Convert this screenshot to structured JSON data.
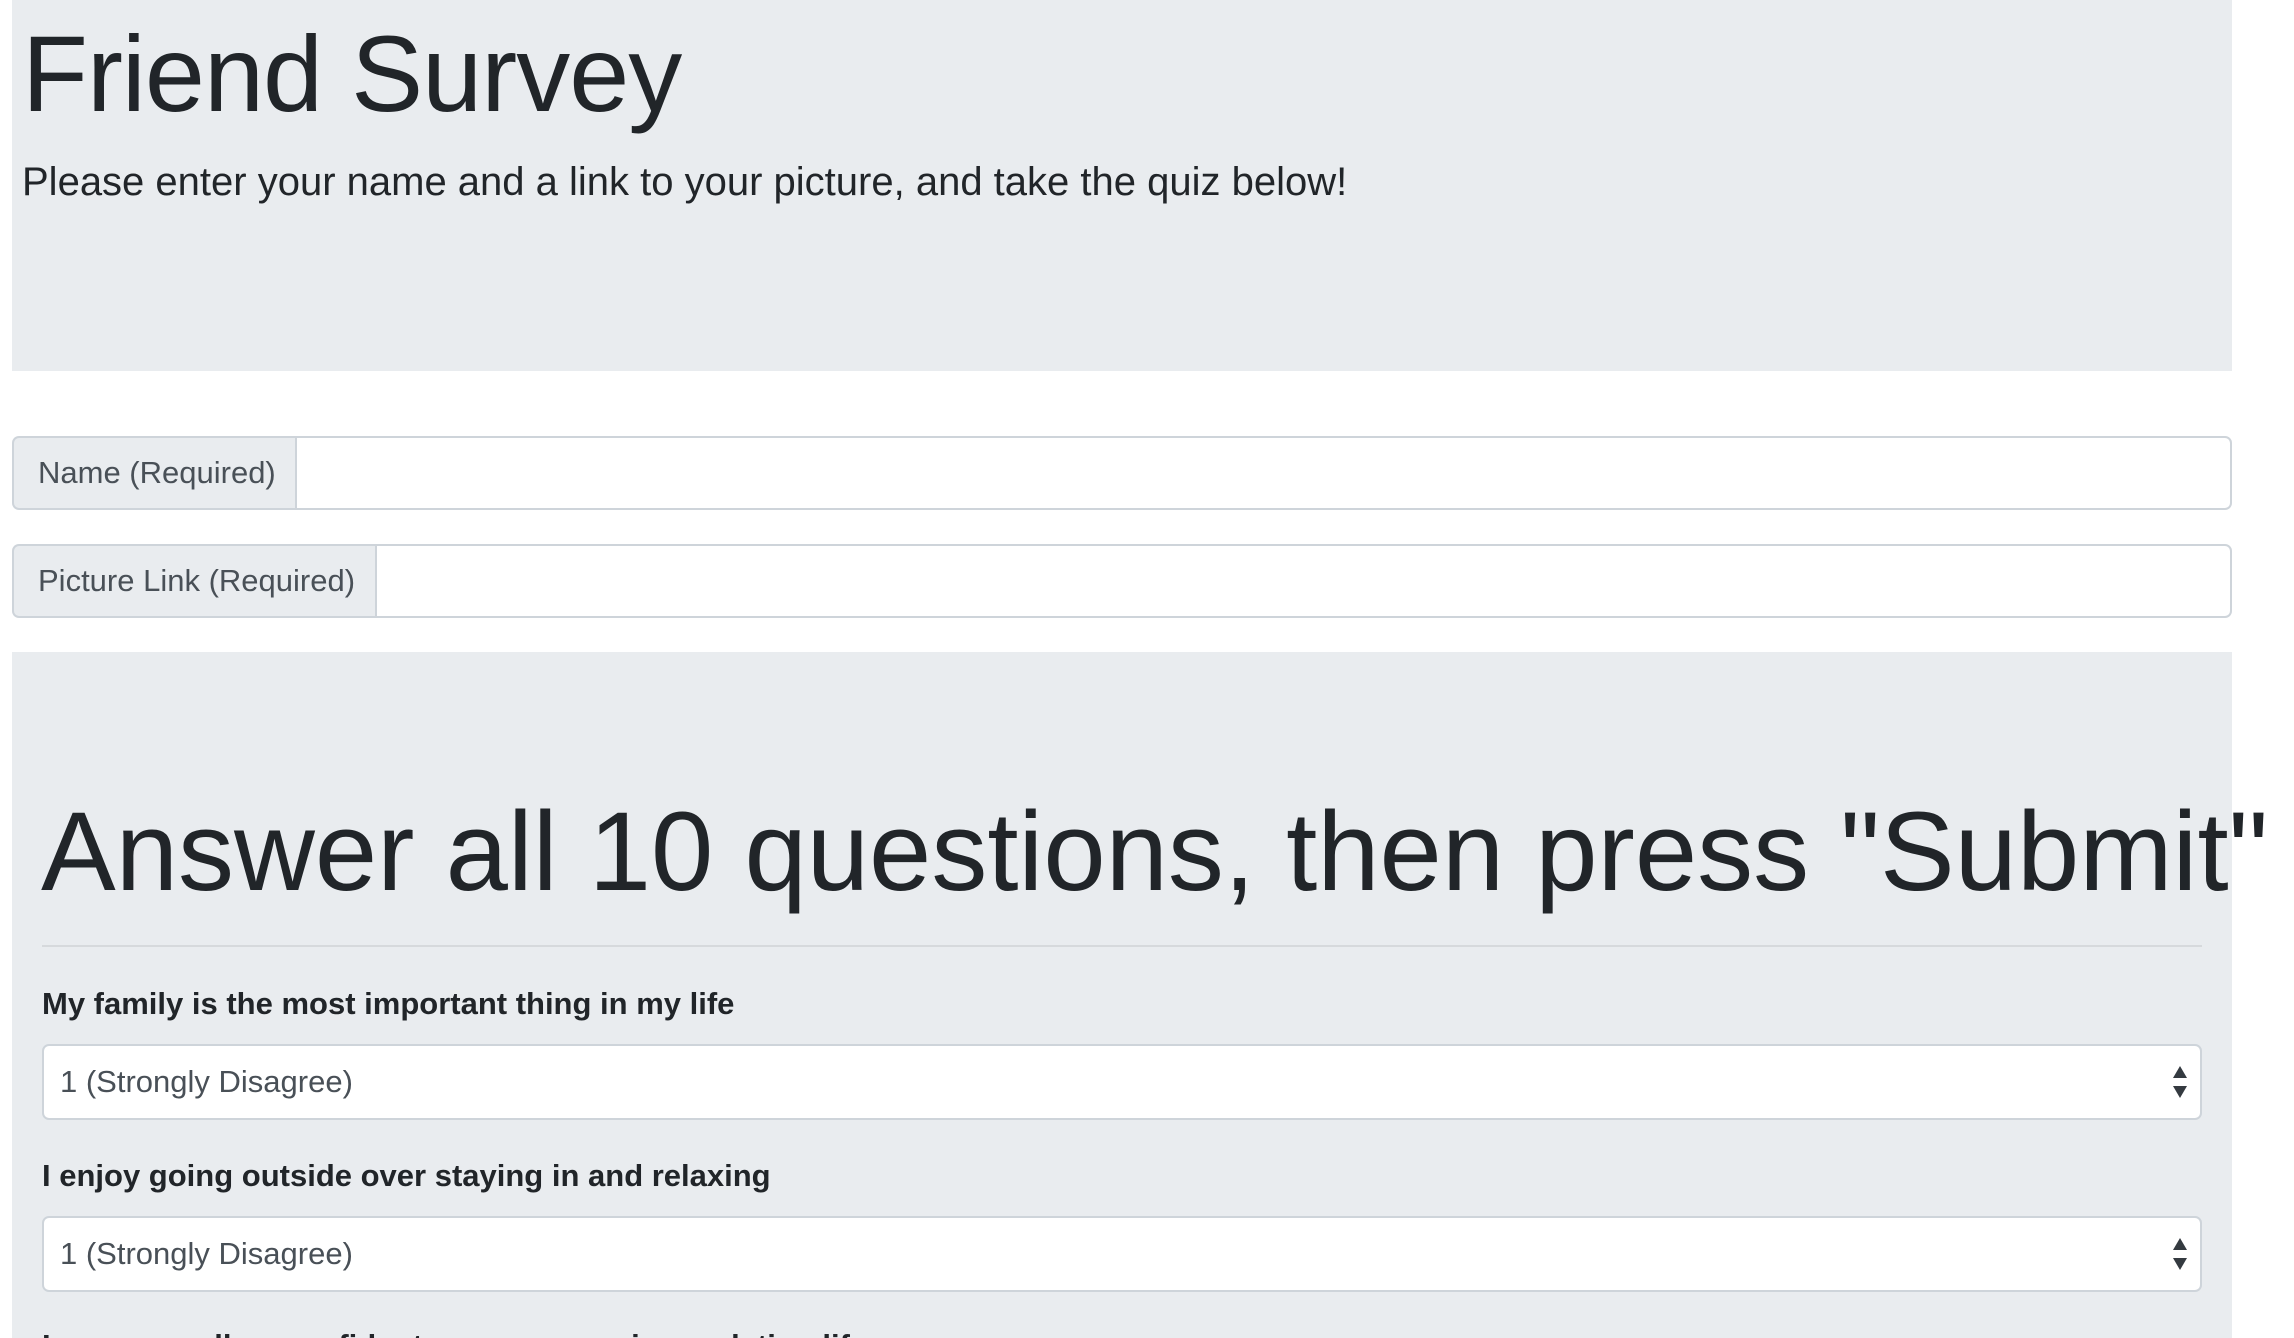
{
  "header": {
    "title": "Friend Survey",
    "subtitle": "Please enter your name and a link to your picture, and take the quiz below!"
  },
  "form": {
    "name_label": "Name (Required)",
    "name_value": "",
    "picture_label": "Picture Link (Required)",
    "picture_value": ""
  },
  "quiz": {
    "heading": "Answer all 10 questions, then press \"Submit\"",
    "questions": [
      {
        "text": "My family is the most important thing in my life",
        "selected": "1 (Strongly Disagree)",
        "caret_icon": "select-updown-arrows"
      },
      {
        "text": "I enjoy going outside over staying in and relaxing",
        "selected": "1 (Strongly Disagree)",
        "caret_icon": "select-updown-arrows"
      },
      {
        "text": "I am generally a confident person, even in my dating life"
      }
    ]
  },
  "colors": {
    "jumbotron_bg": "#e9ecef",
    "border": "#ced4da",
    "text": "#212529",
    "muted_text": "#495057"
  }
}
